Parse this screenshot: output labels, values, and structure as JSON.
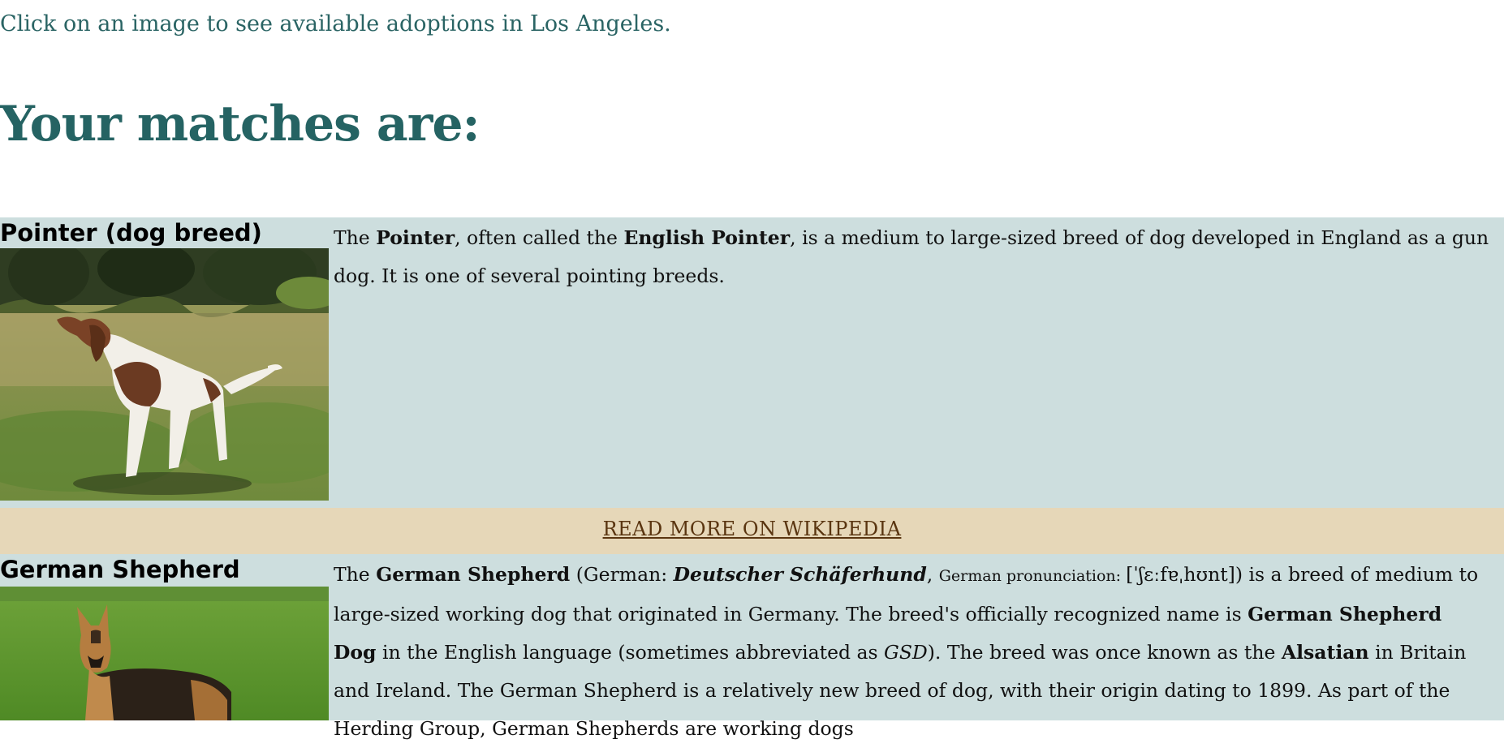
{
  "intro_text": "Click on an image to see available adoptions in Los Angeles.",
  "heading": "Your matches are:",
  "colors": {
    "text_accent": "#256363",
    "card_background": "#cddede",
    "wiki_bar_background": "#e6d7b8",
    "wiki_link": "#5a3510"
  },
  "matches": [
    {
      "name": "Pointer (dog breed)",
      "image": "pointer-dog-photo",
      "description": {
        "p1": "The ",
        "b1": "Pointer",
        "p2": ", often called the ",
        "b2": "English Pointer",
        "p3": ", is a medium to large-sized breed of dog developed in England as a gun dog. It is one of several pointing breeds."
      },
      "read_more_label": "READ MORE ON WIKIPEDIA"
    },
    {
      "name": "German Shepherd",
      "image": "german-shepherd-photo",
      "description": {
        "p1": "The ",
        "b1": "German Shepherd",
        "p2": " (German: ",
        "bi1": "Deutscher Schäferhund",
        "p3": ", ",
        "small1": "German pronunciation: ",
        "ipa": "[ˈʃɛːfɐˌhʊnt]",
        "p4": ") is a breed of medium to large-sized working dog that originated in Germany. The breed's officially recognized name is ",
        "b2": "German Shepherd Dog",
        "p5": " in the English language (sometimes abbreviated as ",
        "i1": "GSD",
        "p6": "). The breed was once known as the ",
        "b3": "Alsatian",
        "p7": " in Britain and Ireland. The German Shepherd is a relatively new breed of dog, with their origin dating to 1899. As part of the Herding Group, German Shepherds are working dogs"
      }
    }
  ]
}
